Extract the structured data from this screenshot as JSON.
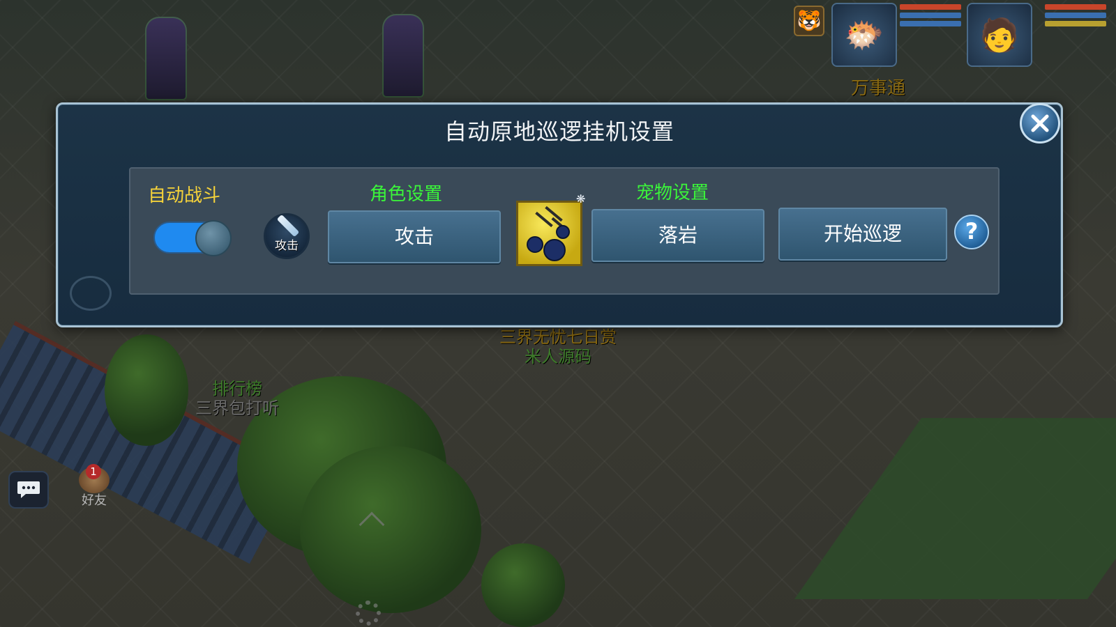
{
  "background": {
    "npc_top_right_name": "万事通",
    "board_label_line1": "三界无忧七日赏",
    "board_label_line2": "米人源码",
    "leaderboard_line1": "排行榜",
    "leaderboard_line2": "三界包打听"
  },
  "hud": {
    "friends_label": "好友",
    "friends_badge": "1"
  },
  "dialog": {
    "title": "自动原地巡逻挂机设置",
    "auto_battle_label": "自动战斗",
    "auto_battle_enabled": true,
    "role_settings_label": "角色设置",
    "role_skill_icon_label": "攻击",
    "role_action_button": "攻击",
    "pet_settings_label": "宠物设置",
    "pet_action_button": "落岩",
    "start_patrol_button": "开始巡逻",
    "help_button": "?"
  },
  "colors": {
    "label_yellow": "#f5d23a",
    "label_green": "#3bf53a",
    "toggle_on": "#1f8af0"
  }
}
